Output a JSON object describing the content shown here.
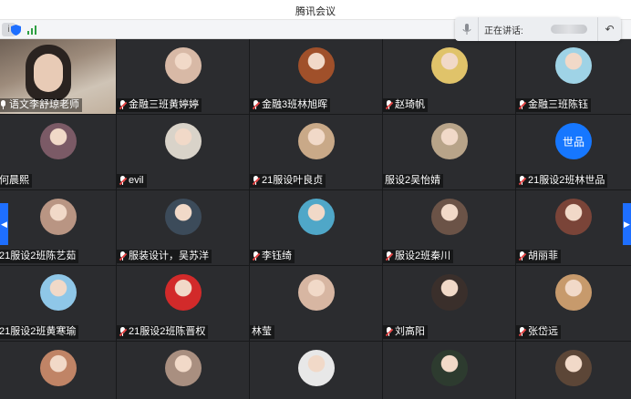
{
  "app": {
    "title": "腾讯会议"
  },
  "speaking": {
    "label": "正在讲话:"
  },
  "participants": [
    {
      "name": "语文李舒琼老师",
      "muted": false,
      "color": "#5a4a40"
    },
    {
      "name": "金融三班黄婷婷",
      "muted": true,
      "color": "#d8b9a6"
    },
    {
      "name": "金融3班林旭晖",
      "muted": true,
      "color": "#a0502a"
    },
    {
      "name": "赵琦帆",
      "muted": true,
      "color": "#e0c36a"
    },
    {
      "name": "金融三班陈钰",
      "muted": true,
      "color": "#9fd3e6"
    },
    {
      "name": "何晨熙",
      "muted": false,
      "color": "#7b5a66"
    },
    {
      "name": "evil",
      "muted": true,
      "color": "#d9d3c9"
    },
    {
      "name": "21服设叶良贞",
      "muted": true,
      "color": "#c9a988"
    },
    {
      "name": "服设2吴怡婧",
      "muted": false,
      "color": "#b8a489"
    },
    {
      "name": "21服设2班林世品",
      "muted": true,
      "color": "#1677ff",
      "avatar_text": "世品"
    },
    {
      "name": "21服设2班陈艺茹",
      "muted": false,
      "color": "#b99583"
    },
    {
      "name": "服装设计，吴苏洋",
      "muted": true,
      "color": "#3c4b5a"
    },
    {
      "name": "李钰绮",
      "muted": true,
      "color": "#4fa7c8"
    },
    {
      "name": "服设2班秦川",
      "muted": true,
      "color": "#6b5347"
    },
    {
      "name": "胡丽菲",
      "muted": true,
      "color": "#7a4438"
    },
    {
      "name": "21服设2班黄寒瑜",
      "muted": false,
      "color": "#8fc7e8"
    },
    {
      "name": "21服设2班陈晋权",
      "muted": true,
      "color": "#d22a2a"
    },
    {
      "name": "林莹",
      "muted": false,
      "color": "#d7b6a2"
    },
    {
      "name": "刘高阳",
      "muted": true,
      "color": "#3a2f2b"
    },
    {
      "name": "张岱远",
      "muted": true,
      "color": "#c79a6c"
    },
    {
      "name": "",
      "muted": false,
      "color": "#c08466"
    },
    {
      "name": "",
      "muted": false,
      "color": "#a98f80"
    },
    {
      "name": "",
      "muted": false,
      "color": "#e8e8e8"
    },
    {
      "name": "",
      "muted": false,
      "color": "#2d3b2f"
    },
    {
      "name": "",
      "muted": false,
      "color": "#5c4637"
    }
  ],
  "colors": {
    "accent": "#1e6fff",
    "tile": "#2b2c2f",
    "muted": "#e64545"
  }
}
